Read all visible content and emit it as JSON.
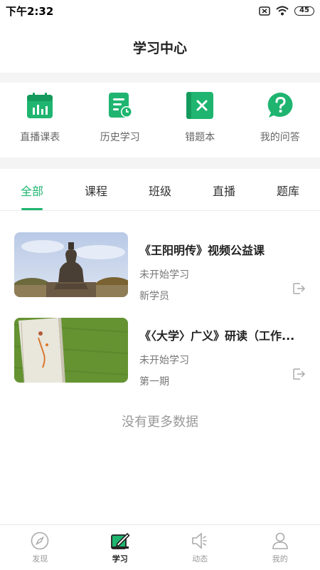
{
  "status_bar": {
    "time": "下午2:32",
    "battery": "45"
  },
  "header": {
    "title": "学习中心"
  },
  "quick_entries": [
    {
      "label": "直播课表",
      "icon": "calendar-chart-icon"
    },
    {
      "label": "历史学习",
      "icon": "document-clock-icon"
    },
    {
      "label": "错题本",
      "icon": "wrong-notebook-icon"
    },
    {
      "label": "我的问答",
      "icon": "question-bubble-icon"
    }
  ],
  "tabs": [
    {
      "label": "全部",
      "active": true
    },
    {
      "label": "课程",
      "active": false
    },
    {
      "label": "班级",
      "active": false
    },
    {
      "label": "直播",
      "active": false
    },
    {
      "label": "题库",
      "active": false
    }
  ],
  "courses": [
    {
      "title": "《王阳明传》视频公益课",
      "status": "未开始学习",
      "meta": "新学员"
    },
    {
      "title": "《〈大学〉广义》研读（工作...",
      "status": "未开始学习",
      "meta": "第一期"
    }
  ],
  "empty_text": "没有更多数据",
  "bottom_nav": [
    {
      "label": "发现",
      "icon": "compass-icon",
      "active": false
    },
    {
      "label": "学习",
      "icon": "study-icon",
      "active": true
    },
    {
      "label": "动态",
      "icon": "speaker-icon",
      "active": false
    },
    {
      "label": "我的",
      "icon": "user-icon",
      "active": false
    }
  ],
  "colors": {
    "accent": "#1fb570",
    "band": "#f4f4f4",
    "muted_text": "#777777"
  }
}
